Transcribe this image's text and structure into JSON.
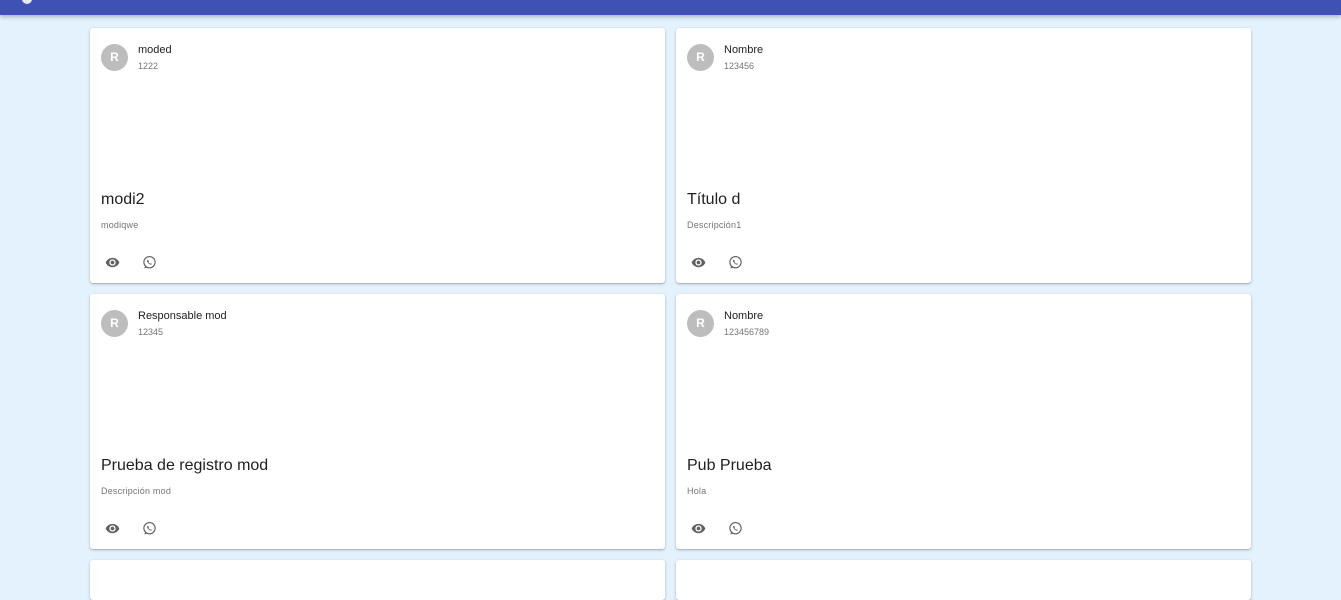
{
  "colors": {
    "appbar": "#3f51b5",
    "background": "#e3f2fd",
    "card": "#ffffff",
    "avatar": "#bdbdbd",
    "icon": "#616161"
  },
  "cards": [
    {
      "avatar_initial": "R",
      "header_title": "moded",
      "header_subtitle": "1222",
      "title": "modi2",
      "description": "modiqwe",
      "actions": [
        "eye-icon",
        "whatsapp-icon"
      ]
    },
    {
      "avatar_initial": "R",
      "header_title": "Nombre",
      "header_subtitle": "123456",
      "title": "Título d",
      "description": "Descripción1",
      "actions": [
        "eye-icon",
        "whatsapp-icon"
      ]
    },
    {
      "avatar_initial": "R",
      "header_title": "Responsable mod",
      "header_subtitle": "12345",
      "title": "Prueba de registro mod",
      "description": "Descripción mod",
      "actions": [
        "eye-icon",
        "whatsapp-icon"
      ]
    },
    {
      "avatar_initial": "R",
      "header_title": "Nombre",
      "header_subtitle": "123456789",
      "title": "Pub Prueba",
      "description": "Hola",
      "actions": [
        "eye-icon",
        "whatsapp-icon"
      ]
    }
  ]
}
